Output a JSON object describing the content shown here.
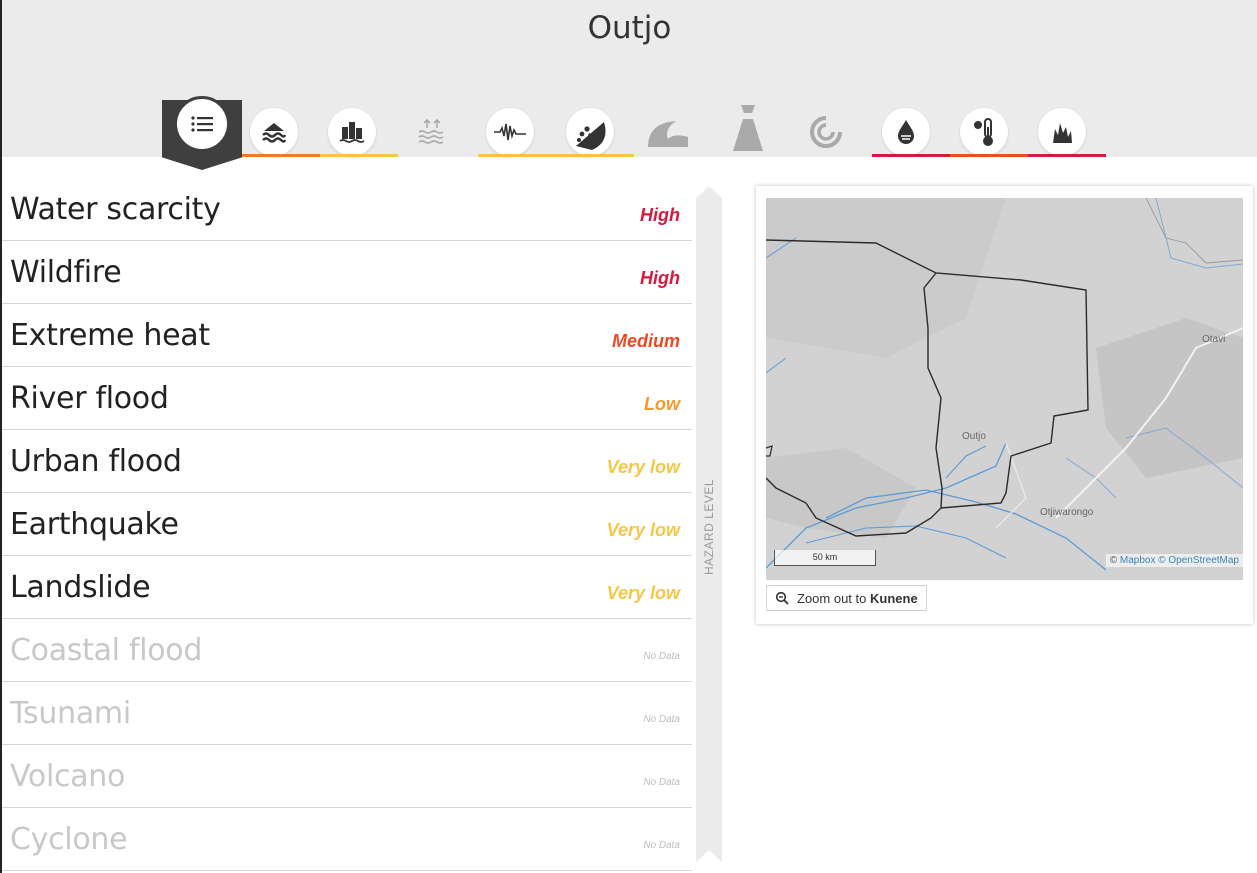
{
  "page": {
    "title": "Outjo"
  },
  "icon_bar": {
    "list_icon": "list-icon",
    "hazards": [
      {
        "icon": "river-flood-icon",
        "state": "active",
        "underline": "#f07a2b"
      },
      {
        "icon": "urban-flood-icon",
        "state": "active",
        "underline": "#f7c644"
      },
      {
        "icon": "coastal-flood-icon",
        "state": "disabled",
        "underline": ""
      },
      {
        "icon": "earthquake-icon",
        "state": "active",
        "underline": "#f7c644"
      },
      {
        "icon": "landslide-icon",
        "state": "active",
        "underline": "#f7c644"
      },
      {
        "icon": "tsunami-icon",
        "state": "disabled",
        "underline": ""
      },
      {
        "icon": "volcano-icon",
        "state": "disabled",
        "underline": ""
      },
      {
        "icon": "cyclone-icon",
        "state": "disabled",
        "underline": ""
      },
      {
        "icon": "water-scarcity-icon",
        "state": "active",
        "underline": "#d9183e"
      },
      {
        "icon": "extreme-heat-icon",
        "state": "active",
        "underline": "#ee4a25"
      },
      {
        "icon": "wildfire-icon",
        "state": "active",
        "underline": "#d9183e"
      }
    ]
  },
  "hazards": [
    {
      "name": "Water scarcity",
      "level": "High",
      "color": "#d9183e"
    },
    {
      "name": "Wildfire",
      "level": "High",
      "color": "#d9183e"
    },
    {
      "name": "Extreme heat",
      "level": "Medium",
      "color": "#ee4a25"
    },
    {
      "name": "River flood",
      "level": "Low",
      "color": "#f39a2b"
    },
    {
      "name": "Urban flood",
      "level": "Very low",
      "color": "#f7c644"
    },
    {
      "name": "Earthquake",
      "level": "Very low",
      "color": "#f7c644"
    },
    {
      "name": "Landslide",
      "level": "Very low",
      "color": "#f7c644"
    },
    {
      "name": "Coastal flood",
      "level": "No Data",
      "color": "#bdbdbd"
    },
    {
      "name": "Tsunami",
      "level": "No Data",
      "color": "#bdbdbd"
    },
    {
      "name": "Volcano",
      "level": "No Data",
      "color": "#bdbdbd"
    },
    {
      "name": "Cyclone",
      "level": "No Data",
      "color": "#bdbdbd"
    }
  ],
  "level_axis": {
    "label": "HAZARD LEVEL"
  },
  "map": {
    "places": [
      "Otavi",
      "Outjo",
      "Otjiwarongo"
    ],
    "scale_label": "50 km",
    "attribution_prefix": "©",
    "attribution_mapbox": "Mapbox",
    "attribution_osm": "© OpenStreetMap",
    "zoom_label": "Zoom out to",
    "zoom_region": "Kunene"
  }
}
